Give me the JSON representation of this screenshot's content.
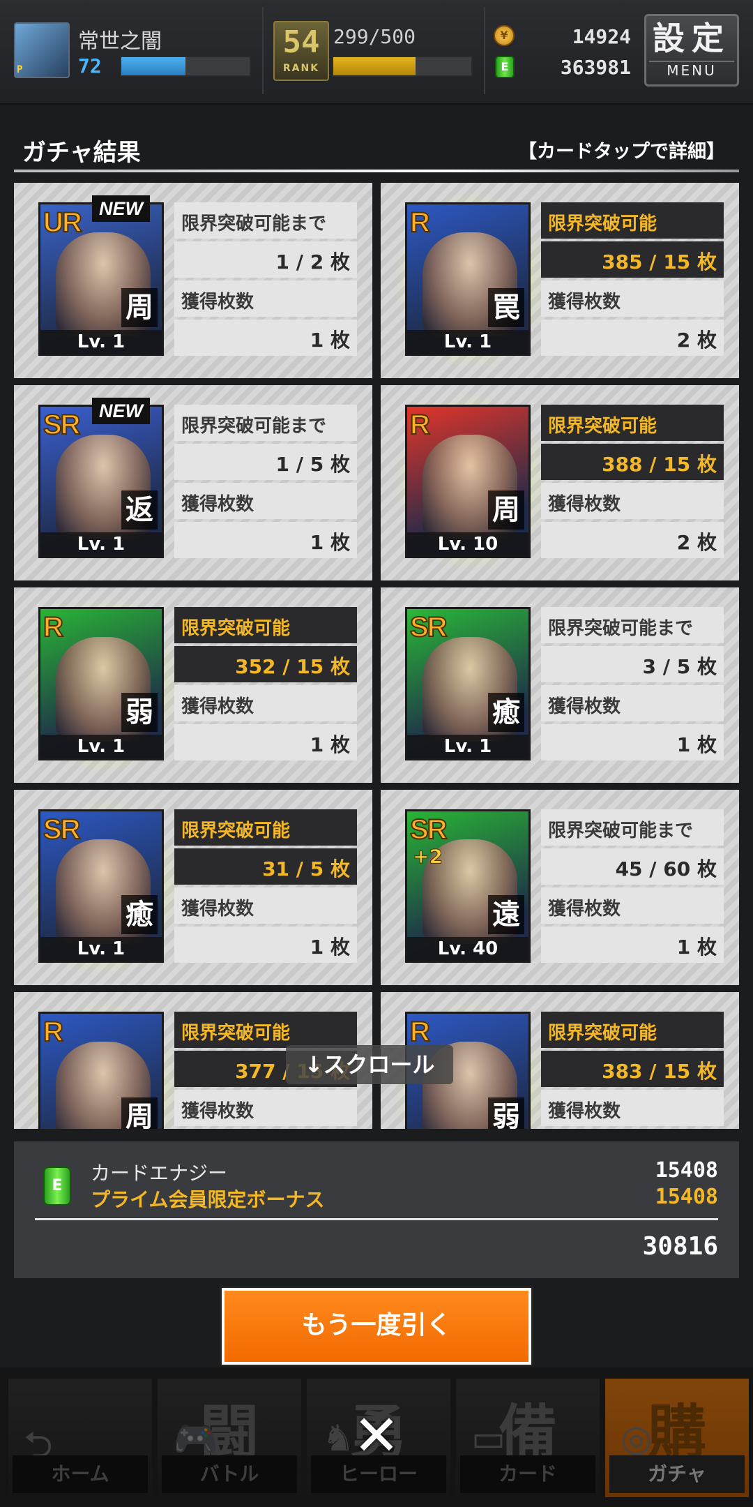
{
  "player": {
    "name": "常世之闇",
    "level": "72",
    "level_fraction": 0.5,
    "rank": "54",
    "rank_label": "RANK",
    "stamina": "299/500",
    "stamina_fraction": 0.598,
    "coins": "14924",
    "energy": "363981",
    "coin_glyph": "¥",
    "energy_glyph": "E"
  },
  "menu": {
    "kanji": "設定",
    "label": "MENU"
  },
  "result": {
    "title": "ガチャ結果",
    "hint": "【カードタップで詳細】"
  },
  "labels": {
    "limit_break_ready": "限界突破可能",
    "limit_break_until": "限界突破可能まで",
    "obtained": "獲得枚数",
    "unit": "枚",
    "new": "NEW"
  },
  "cards": [
    {
      "rarity": "UR",
      "role": "周",
      "level": "Lv. 1",
      "new": true,
      "ready": false,
      "progress": "1 / 2",
      "obtained": "1",
      "rarity_color": "#ffb02e",
      "bg": "#3a63c8",
      "glow": false
    },
    {
      "rarity": "R",
      "role": "罠",
      "level": "Lv. 1",
      "new": false,
      "ready": true,
      "progress": "385 / 15",
      "obtained": "2",
      "rarity_color": "#ffb02e",
      "bg": "#2d59c4",
      "glow": true
    },
    {
      "rarity": "SR",
      "role": "返",
      "level": "Lv. 1",
      "new": true,
      "ready": false,
      "progress": "1 / 5",
      "obtained": "1",
      "rarity_color": "#ffb02e",
      "bg": "#3b5fd1",
      "glow": false
    },
    {
      "rarity": "R",
      "role": "周",
      "level": "Lv. 10",
      "new": false,
      "ready": true,
      "progress": "388 / 15",
      "obtained": "2",
      "rarity_color": "#ffb02e",
      "bg": "#e2352a",
      "glow": true
    },
    {
      "rarity": "R",
      "role": "弱",
      "level": "Lv. 1",
      "new": false,
      "ready": true,
      "progress": "352 / 15",
      "obtained": "1",
      "rarity_color": "#ffb02e",
      "bg": "#29b535",
      "glow": true
    },
    {
      "rarity": "SR",
      "role": "癒",
      "level": "Lv. 1",
      "new": false,
      "ready": false,
      "progress": "3 / 5",
      "obtained": "1",
      "rarity_color": "#ffb02e",
      "bg": "#2ab838",
      "glow": false
    },
    {
      "rarity": "SR",
      "role": "癒",
      "level": "Lv. 1",
      "new": false,
      "ready": true,
      "progress": "31 / 5",
      "obtained": "1",
      "rarity_color": "#ffb02e",
      "bg": "#2d59c4",
      "glow": true
    },
    {
      "rarity": "SR",
      "role": "遠",
      "level": "Lv. 40",
      "new": false,
      "ready": false,
      "progress": "45 / 60",
      "obtained": "1",
      "rarity_color": "#ffb02e",
      "bg": "#29b535",
      "glow": false,
      "plus": "+2"
    },
    {
      "rarity": "R",
      "role": "周",
      "level": "",
      "new": false,
      "ready": true,
      "progress": "377 / 15",
      "obtained": "",
      "rarity_color": "#ffb02e",
      "bg": "#2d59c4",
      "glow": true
    },
    {
      "rarity": "R",
      "role": "弱",
      "level": "",
      "new": false,
      "ready": true,
      "progress": "383 / 15",
      "obtained": "",
      "rarity_color": "#ffb02e",
      "bg": "#2d59c4",
      "glow": true
    }
  ],
  "scroll_hint": "↓スクロール",
  "summary": {
    "label1": "カードエナジー",
    "value1": "15408",
    "label2": "プライム会員限定ボーナス",
    "value2": "15408",
    "total": "30816",
    "icon_glyph": "E"
  },
  "again_button": "もう一度引く",
  "nav": [
    {
      "label": "ホーム",
      "big": "",
      "icon": "⮌"
    },
    {
      "label": "バトル",
      "big": "闘",
      "icon": "🎮"
    },
    {
      "label": "ヒーロー",
      "big": "勇",
      "icon": "♞"
    },
    {
      "label": "カード",
      "big": "備",
      "icon": "▭"
    },
    {
      "label": "ガチャ",
      "big": "購",
      "icon": "◎",
      "active": true
    }
  ],
  "close_glyph": "✕"
}
